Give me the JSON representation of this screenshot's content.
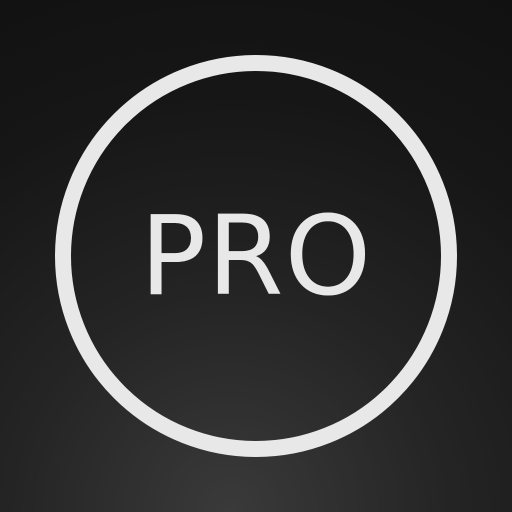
{
  "app_icon": {
    "label": "PRO",
    "icon_name": "pro-badge-icon",
    "colors": {
      "foreground": "#e8e8e8",
      "background_top": "#111111",
      "background_bottom": "#3a3a3a"
    }
  }
}
